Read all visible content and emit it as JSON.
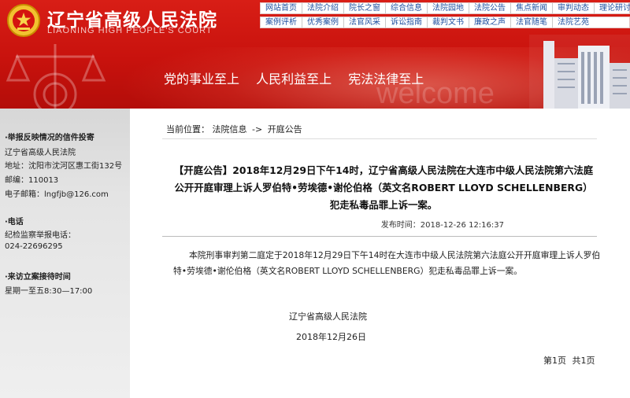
{
  "header": {
    "site_title": "辽宁省高级人民法院",
    "site_subtitle": "LIAONING HIGH PEOPLE'S COURT",
    "slogans": [
      "党的事业至上",
      "人民利益至上",
      "宪法法律至上"
    ],
    "watermark": "welcome"
  },
  "nav": {
    "row1": [
      "网站首页",
      "法院介绍",
      "院长之窗",
      "综合信息",
      "法院园地",
      "法院公告",
      "焦点新闻",
      "审判动态",
      "理论研讨"
    ],
    "row2": [
      "案例评析",
      "优秀案例",
      "法官风采",
      "诉讼指南",
      "裁判文书",
      "廉政之声",
      "法官随笔",
      "法院艺苑"
    ]
  },
  "sidebar": {
    "letter_heading": "·举报反映情况的信件投寄",
    "letter_lines": [
      "辽宁省高级人民法院",
      "地址：沈阳市沈河区惠工街132号",
      "邮编：110013",
      "电子邮箱：lngfjb@126.com"
    ],
    "phone_heading": "·电话",
    "phone_lines": [
      "纪检监察举报电话：",
      "024-22696295"
    ],
    "visit_heading": "·来访立案接待时间",
    "visit_lines": [
      "星期一至五8:30—17:00"
    ]
  },
  "breadcrumb": {
    "prefix": "当前位置：",
    "items": [
      "法院信息",
      "开庭公告"
    ],
    "separator": "->"
  },
  "article": {
    "title": "【开庭公告】2018年12月29日下午14时，辽宁省高级人民法院在大连市中级人民法院第六法庭公开开庭审理上诉人罗伯特•劳埃德•谢伦伯格（英文名ROBERT LLOYD SCHELLENBERG）犯走私毒品罪上诉一案。",
    "publish_label": "发布时间：",
    "publish_time": "2018-12-26 12:16:37",
    "body": "本院刑事审判第二庭定于2018年12月29日下午14时在大连市中级人民法院第六法庭公开开庭审理上诉人罗伯特•劳埃德•谢伦伯格（英文名ROBERT LLOYD SCHELLENBERG）犯走私毒品罪上诉一案。",
    "signature_org": "辽宁省高级人民法院",
    "signature_date": "2018年12月26日"
  },
  "pager": {
    "current": "第1页",
    "total": "共1页"
  }
}
